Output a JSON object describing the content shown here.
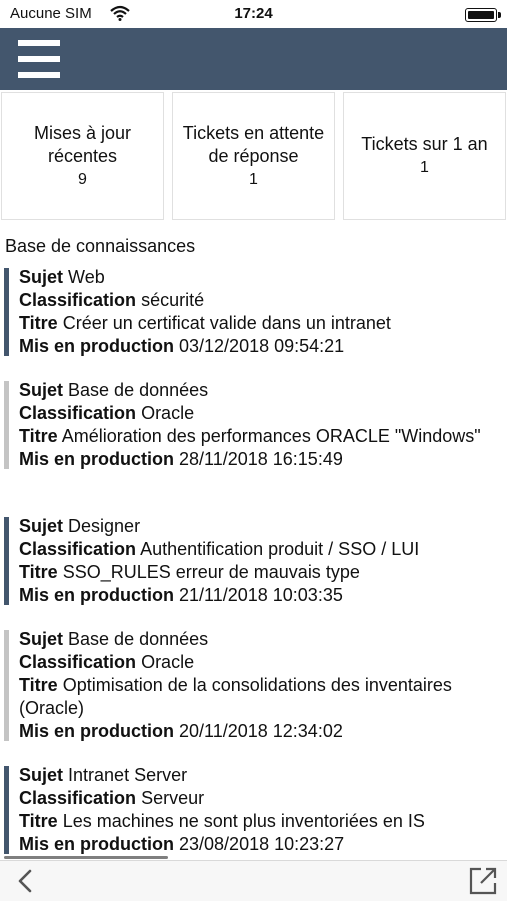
{
  "status_bar": {
    "carrier": "Aucune SIM",
    "time": "17:24",
    "wifi_icon": "wifi-icon",
    "battery_icon": "battery-icon"
  },
  "header": {
    "menu_icon": "hamburger-menu-icon",
    "color": "#43566d"
  },
  "tiles": [
    {
      "label": "Mises à jour récentes",
      "count": "9"
    },
    {
      "label": "Tickets en attente de réponse",
      "count": "1"
    },
    {
      "label": "Tickets sur 1 an",
      "count": "1"
    }
  ],
  "knowledge_base": {
    "title": "Base de connaissances",
    "labels": {
      "subject": "Sujet",
      "classification": "Classification",
      "title": "Titre",
      "production": "Mis en production"
    },
    "items": [
      {
        "subject": "Web",
        "classification": "sécurité",
        "title": "Créer un certificat valide dans un intranet",
        "production": "03/12/2018 09:54:21",
        "accent": "#43566d"
      },
      {
        "subject": "Base de données",
        "classification": "Oracle",
        "title": "Amélioration des performances ORACLE \"Windows\"",
        "production": "28/11/2018 16:15:49",
        "accent": "#c4c4c4"
      },
      {
        "subject": "Designer",
        "classification": "Authentification produit / SSO / LUI",
        "title": "SSO_RULES erreur de mauvais type",
        "production": "21/11/2018 10:03:35",
        "accent": "#43566d"
      },
      {
        "subject": "Base de données",
        "classification": "Oracle",
        "title": "Optimisation de la consolidations des inventaires (Oracle)",
        "production": "20/11/2018 12:34:02",
        "accent": "#c4c4c4"
      },
      {
        "subject": "Intranet Server",
        "classification": "Serveur",
        "title": "Les machines ne sont plus inventoriées en IS",
        "production": "23/08/2018 10:23:27",
        "accent": "#43566d"
      }
    ]
  },
  "bottom_bar": {
    "back_icon": "chevron-left-icon",
    "open_icon": "open-external-icon"
  }
}
